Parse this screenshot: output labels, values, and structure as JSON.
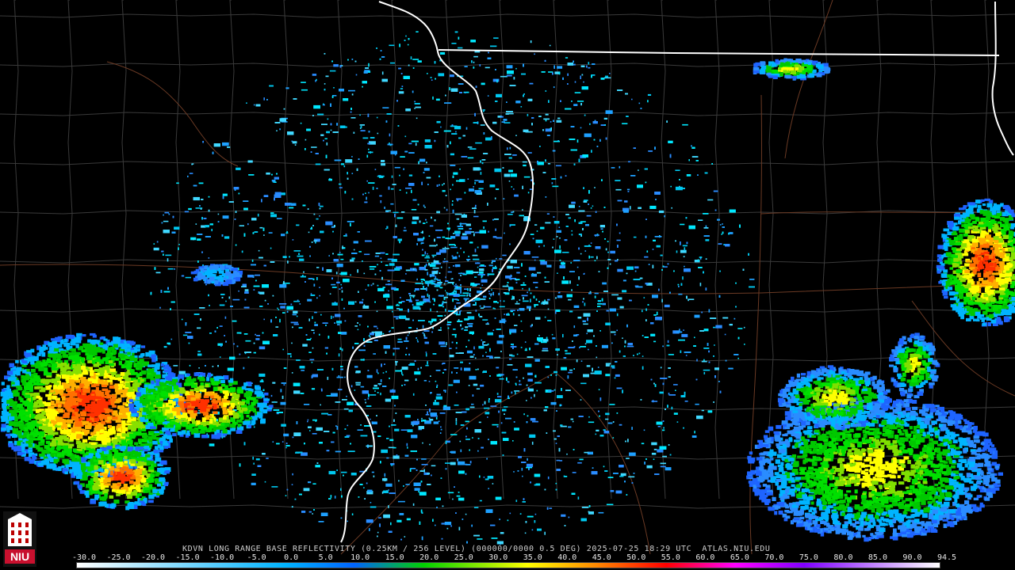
{
  "radar": {
    "caption": "KDVN LONG RANGE BASE REFLECTIVITY (0.25KM / 256 LEVEL) (000000/0000 0.5 DEG) 2025-07-25 18:29 UTC  ATLAS.NIU.EDU",
    "logo_text": "NIU"
  },
  "colorbar": {
    "ticks": [
      "-30.0",
      "-25.0",
      "-20.0",
      "-15.0",
      "-10.0",
      "-5.0",
      "0.0",
      "5.0",
      "10.0",
      "15.0",
      "20.0",
      "25.0",
      "30.0",
      "35.0",
      "40.0",
      "45.0",
      "50.0",
      "55.0",
      "60.0",
      "65.0",
      "70.0",
      "75.0",
      "80.0",
      "85.0",
      "90.0",
      "94.5"
    ],
    "stops": [
      {
        "dbz": -30,
        "color": "#ffffff"
      },
      {
        "dbz": 0,
        "color": "#00b4ff"
      },
      {
        "dbz": 10,
        "color": "#0064ff"
      },
      {
        "dbz": 20,
        "color": "#00d000"
      },
      {
        "dbz": 35,
        "color": "#ffff00"
      },
      {
        "dbz": 45,
        "color": "#ff8800"
      },
      {
        "dbz": 55,
        "color": "#ff0000"
      },
      {
        "dbz": 65,
        "color": "#ff00ff"
      },
      {
        "dbz": 75,
        "color": "#8000ff"
      },
      {
        "dbz": 94.5,
        "color": "#ffffff"
      }
    ]
  },
  "colors": {
    "background": "#000000",
    "county_lines": "#3a3a3a",
    "state_lines": "#ffffff",
    "roads": "#6b3a24"
  }
}
